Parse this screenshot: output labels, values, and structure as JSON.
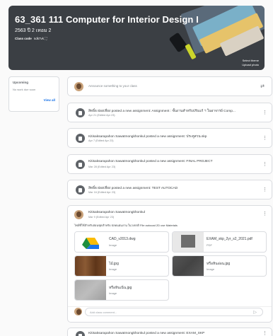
{
  "banner": {
    "title": "63_361 111 Computer for Interior Design I",
    "subtitle": "2563 ปี 2 เทอม 2",
    "class_code_label": "Class code",
    "class_code_value": "ndk7vk",
    "select_theme": "Select theme",
    "upload_photo": "Upload photo"
  },
  "upcoming": {
    "title": "Upcoming",
    "empty_text": "No work due soon",
    "view_all": "View all"
  },
  "announce": {
    "placeholder": "Announce something to your class"
  },
  "posts": [
    {
      "title": "สิทธิ์ธ ผ่องเที่ยง posted a new assignment: Assignment : ขั้นงานสำหรับปรับแก้ ฯ ในอาจารย์ Comp...",
      "date": "Apr 21 (Edited Apr 23)"
    },
    {
      "title": "Kitisaksarapahon Sawatmongkhonkul posted a new assignment: ประตูสวน.skp",
      "date": "Apr 7 (Edited Apr 23)"
    },
    {
      "title": "Kitisaksarapahon Sawatmongkhonkul posted a new assignment: FINAL PROJECT",
      "date": "Mar 28 (Edited Apr 23)"
    },
    {
      "title": "สิทธิ์ธ ผ่องเที่ยง posted a new assignment: TEST AUTOCAD",
      "date": "Mar 16 (Edited Apr 23)"
    }
  ],
  "material_post": {
    "author": "Kitisaksarapahon Sawatmongkhonkul",
    "date": "Mar 9 (Edited Apr 23)",
    "body": "ไฟล์ที่ใช้สำหรับสอนชุดสำหรับ ปลดแผ่นงาน ในวงจรดิ File autocad 2D use Materials",
    "attachments": [
      {
        "name": "CAD_v2013.dwg",
        "type": "Image"
      },
      {
        "name": "EXAM_skp_2yr_s2_2021.pdf",
        "type": "PDF"
      },
      {
        "name": "ไม้.jpg",
        "type": "Image"
      },
      {
        "name": "หรือหินอ่อน.jpg",
        "type": "Image"
      },
      {
        "name": "หรือหินเนิ่น.jpg",
        "type": "Image"
      }
    ],
    "comment_placeholder": "Add class comment..."
  },
  "last_post": {
    "title": "Kitisaksarapahon Sawatmongkhonkul posted a new assignment: EXAM_SKP"
  }
}
